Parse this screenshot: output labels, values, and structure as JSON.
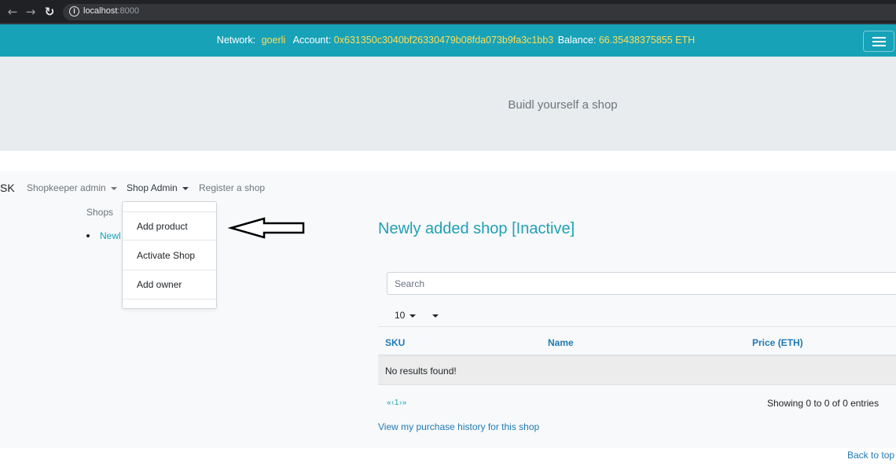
{
  "browser": {
    "url_host": "localhost",
    "url_port": ":8000",
    "back_glyph": "←",
    "forward_glyph": "→",
    "reload_glyph": "↻"
  },
  "topbar": {
    "network_label": "Network:",
    "network_value": "goerli",
    "account_label": "Account:",
    "account_value": "0x631350c3040bf26330479b08fda073b9fa3c1bb3",
    "balance_label": "Balance:",
    "balance_value": "66.35438375855 ETH",
    "value_color": "#ffde59",
    "bar_color": "#17a2b8"
  },
  "jumbotron": {
    "text": "Buidl yourself a shop"
  },
  "nav": {
    "brand": "SK",
    "shopkeeper_admin": "Shopkeeper admin",
    "shop_admin": "Shop Admin",
    "register_shop": "Register a shop"
  },
  "dropdown": {
    "items": [
      "Add product",
      "Activate Shop",
      "Add owner"
    ]
  },
  "sidebar": {
    "heading": "Shops",
    "items": [
      "Newl"
    ]
  },
  "shop": {
    "title": "Newly added shop [Inactive]"
  },
  "table": {
    "search_placeholder": "Search",
    "page_size": "10",
    "columns": [
      "SKU",
      "Name",
      "Price (ETH)"
    ],
    "empty_message": "No results found!",
    "pager": "«‹1›»",
    "entries_info": "Showing 0 to 0 of 0 entries"
  },
  "links": {
    "purchase_history": "View my purchase history for this shop",
    "back_to_top": "Back to top"
  },
  "icons": {
    "info": "info-circle-icon",
    "menu": "hamburger-menu-icon",
    "annotation": "left-arrow-icon"
  }
}
